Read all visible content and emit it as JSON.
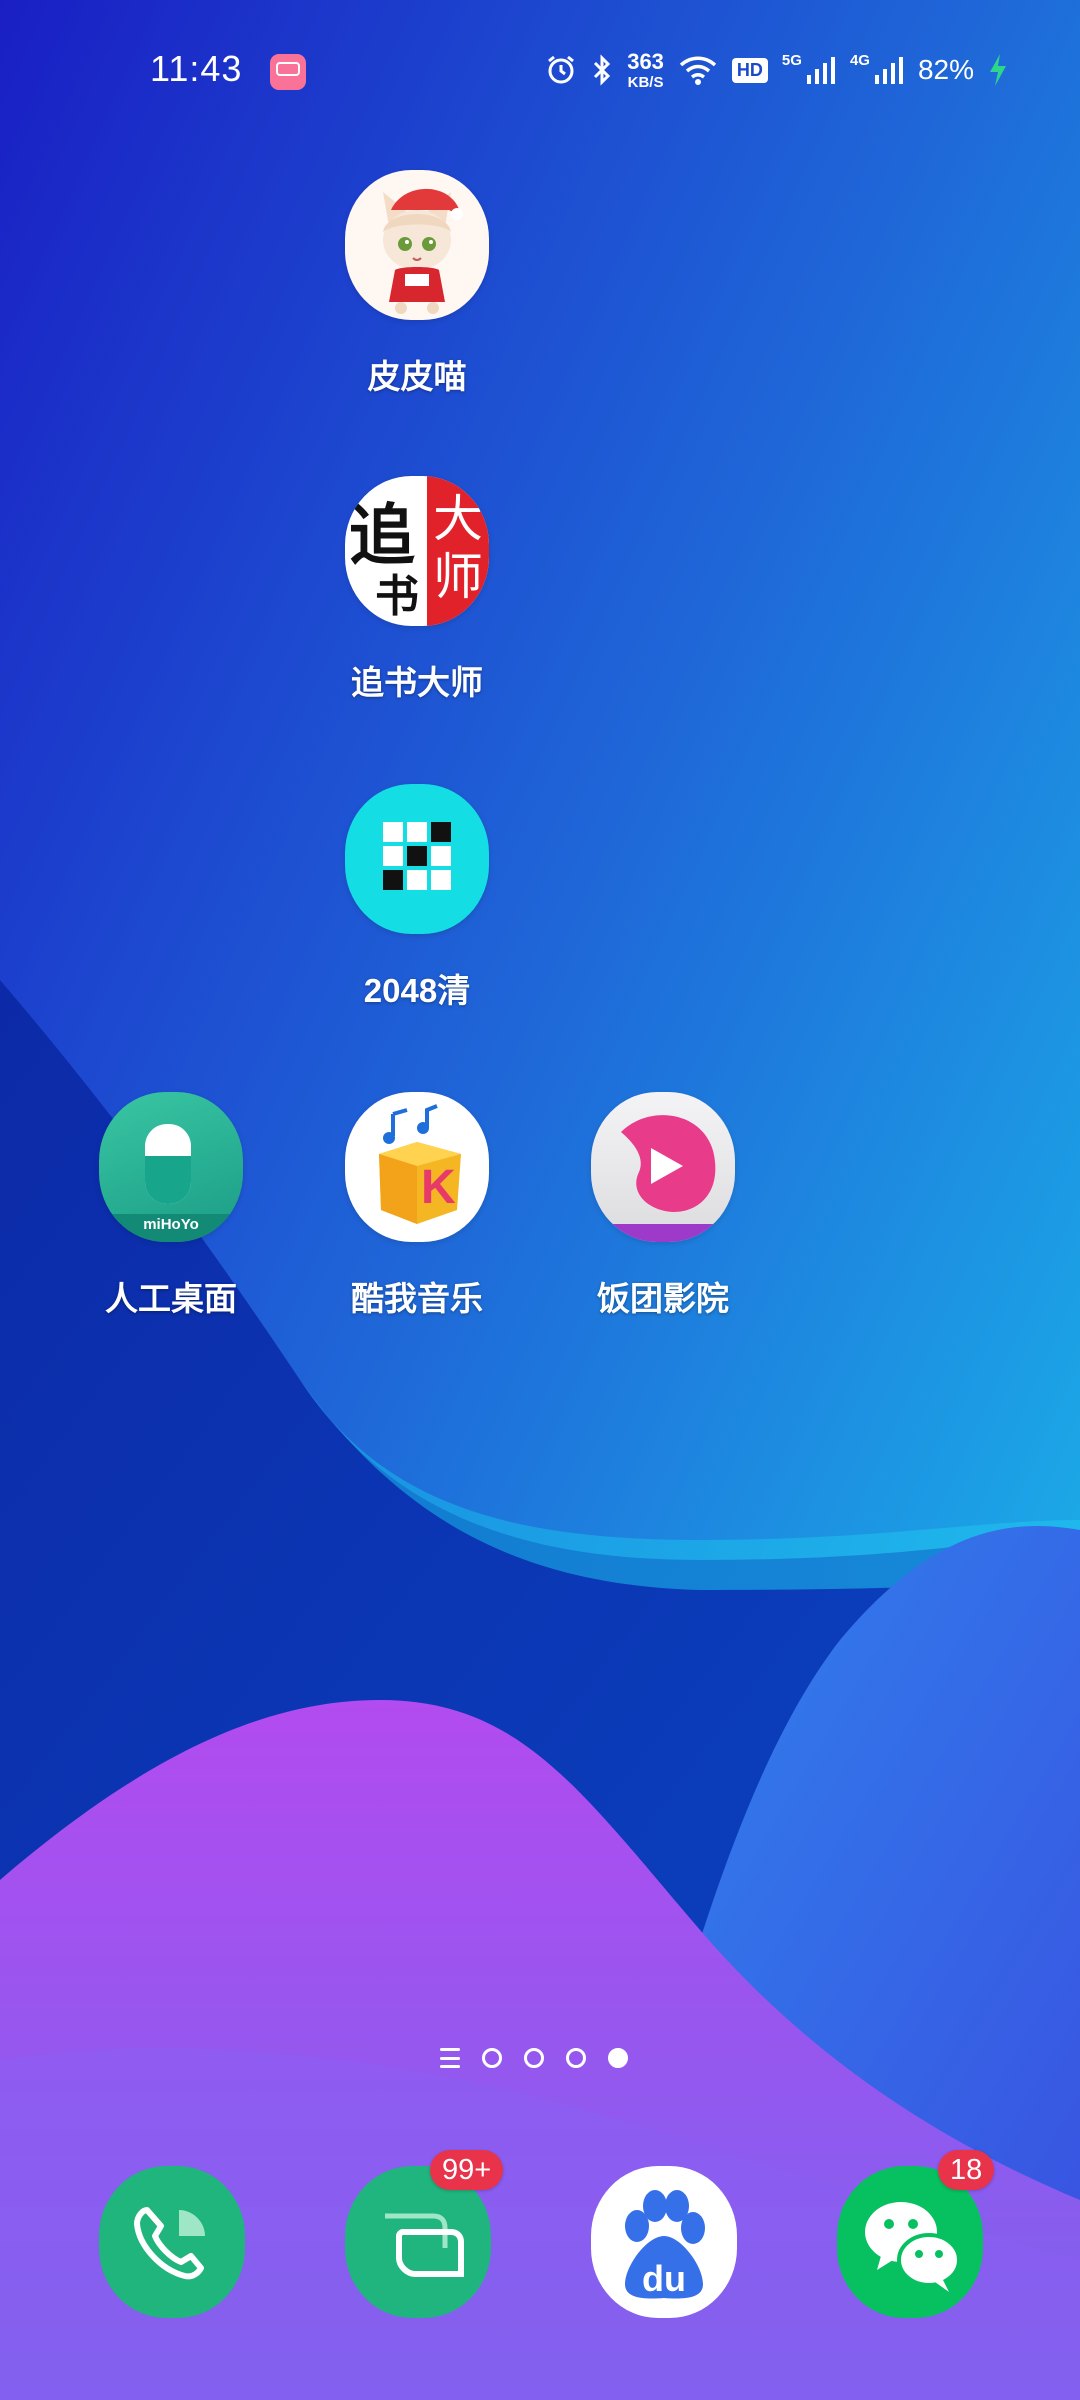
{
  "status_bar": {
    "time": "11:43",
    "net_speed_value": "363",
    "net_speed_unit": "KB/S",
    "hd_label": "HD",
    "network_5g": "5G",
    "network_4g": "4G",
    "battery": "82%",
    "icons": [
      "bilibili-notification-icon",
      "alarm-icon",
      "bluetooth-icon",
      "wifi-icon",
      "signal-5g-icon",
      "signal-4g-icon",
      "charging-icon"
    ]
  },
  "apps": [
    {
      "name": "皮皮喵",
      "icon": "pipimiao-icon"
    },
    {
      "name": "追书大师",
      "icon": "zhuishu-icon",
      "icon_text_left": "追",
      "icon_text_small": "书",
      "icon_text_right": "大师"
    },
    {
      "name": "2048清",
      "icon": "game-2048-icon"
    },
    {
      "name": "人工桌面",
      "icon": "mihoyo-desktop-icon",
      "icon_text": "miHoYo"
    },
    {
      "name": "酷我音乐",
      "icon": "kuwo-music-icon",
      "icon_text": "K"
    },
    {
      "name": "饭团影院",
      "icon": "fantuan-cinema-icon"
    }
  ],
  "dock": [
    {
      "name": "phone",
      "icon": "phone-icon"
    },
    {
      "name": "messages",
      "icon": "messages-icon",
      "badge": "99+"
    },
    {
      "name": "baidu",
      "icon": "baidu-icon",
      "icon_text": "du"
    },
    {
      "name": "wechat",
      "icon": "wechat-icon",
      "badge": "18"
    }
  ],
  "page_indicator": {
    "pages": 4,
    "active": 4
  },
  "colors": {
    "phone_green": "#1fb57c",
    "messages_green": "#20b47e",
    "wechat_green": "#07c160",
    "badge_red": "#e8334a",
    "baidu_blue": "#3670e8"
  }
}
